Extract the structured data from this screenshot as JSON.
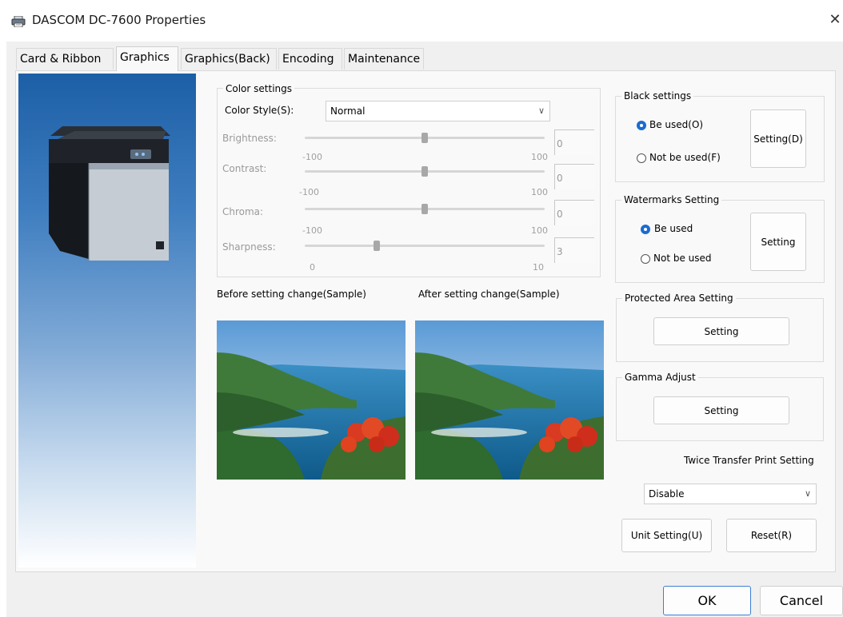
{
  "window": {
    "title": "DASCOM DC-7600 Properties",
    "close_label": "✕"
  },
  "tabs": [
    {
      "label": "Card & Ribbon"
    },
    {
      "label": "Graphics"
    },
    {
      "label": "Graphics(Back)"
    },
    {
      "label": "Encoding"
    },
    {
      "label": "Maintenance"
    }
  ],
  "color_settings": {
    "title": "Color settings",
    "style_label": "Color Style(S):",
    "style_value": "Normal",
    "sliders": [
      {
        "label": "Brightness:",
        "value": "0",
        "min_label": "-100",
        "max_label": "100",
        "level": 0.5
      },
      {
        "label": "Contrast:",
        "value": "0",
        "min_label": "-100",
        "max_label": "100",
        "level": 0.5
      },
      {
        "label": "Chroma:",
        "value": "0",
        "min_label": "-100",
        "max_label": "100",
        "level": 0.5
      },
      {
        "label": "Sharpness:",
        "value": "3",
        "min_label": "0",
        "max_label": "10",
        "level": 0.3
      }
    ]
  },
  "samples": {
    "before_label": "Before setting change(Sample)",
    "after_label": "After setting change(Sample)"
  },
  "black_settings": {
    "title": "Black settings",
    "option_used": "Be used(O)",
    "option_not_used": "Not be used(F)",
    "selected": "used",
    "button": "Setting(D)"
  },
  "watermarks": {
    "title": "Watermarks Setting",
    "option_used": "Be used",
    "option_not_used": "Not be used",
    "selected": "used",
    "button": "Setting"
  },
  "protected_area": {
    "title": "Protected Area Setting",
    "button": "Setting"
  },
  "gamma": {
    "title": "Gamma Adjust",
    "button": "Setting"
  },
  "twice_transfer": {
    "label": "Twice Transfer Print Setting",
    "value": "Disable"
  },
  "footer": {
    "unit_setting": "Unit Setting(U)",
    "reset": "Reset(R)",
    "ok": "OK",
    "cancel": "Cancel"
  }
}
